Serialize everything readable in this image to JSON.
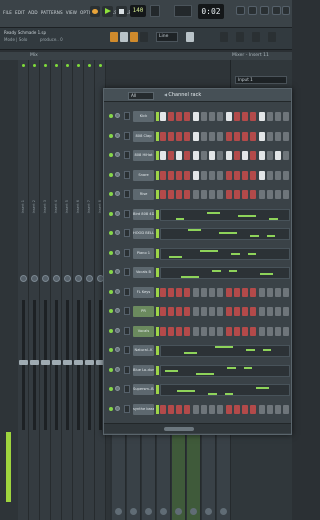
{
  "menu": [
    "FILE",
    "EDIT",
    "ADD",
    "PATTERNS",
    "VIEW",
    "OPTIONS",
    "TOOLS",
    "HELP"
  ],
  "transport": {
    "tempo": "140",
    "time": "0:02"
  },
  "project": {
    "title": "Ready Schmade 1.sp",
    "mode": "Mode | Solo",
    "version": "produce.. 0"
  },
  "toolbar2": {
    "pattern": "Line"
  },
  "mixer": {
    "header": "Mix",
    "insert_label": "Mixer - Insert 11",
    "input": "Input 1"
  },
  "mixer_strips": [
    "Insert 1",
    "Insert 2",
    "Insert 3",
    "Insert 4",
    "Insert 5",
    "Insert 6",
    "Insert 7",
    "Insert 8"
  ],
  "rack": {
    "filter": "All",
    "title": "Channel rack",
    "channels": [
      {
        "name": "Kick",
        "type": "steps",
        "steps": [
          1,
          0,
          0,
          0,
          1,
          0,
          0,
          0,
          1,
          0,
          0,
          0,
          1,
          0,
          0,
          0
        ]
      },
      {
        "name": "808 Clap",
        "type": "steps",
        "steps": [
          0,
          0,
          0,
          0,
          1,
          0,
          0,
          0,
          0,
          0,
          0,
          0,
          1,
          0,
          0,
          0
        ]
      },
      {
        "name": "808 HiHat",
        "type": "steps",
        "steps": [
          1,
          0,
          1,
          0,
          1,
          0,
          1,
          0,
          1,
          0,
          1,
          0,
          1,
          0,
          1,
          0
        ]
      },
      {
        "name": "Snare",
        "type": "steps",
        "steps": [
          0,
          0,
          0,
          0,
          1,
          0,
          0,
          0,
          0,
          0,
          0,
          0,
          1,
          0,
          0,
          0
        ]
      },
      {
        "name": "Rise",
        "type": "steps",
        "steps": [
          0,
          0,
          0,
          0,
          0,
          0,
          0,
          0,
          0,
          0,
          0,
          0,
          0,
          0,
          0,
          0
        ]
      },
      {
        "name": "Bird 808 4D",
        "type": "roll"
      },
      {
        "name": "HOOD BELL",
        "type": "roll"
      },
      {
        "name": "Piano 1",
        "type": "roll"
      },
      {
        "name": "Vocals B",
        "type": "roll"
      },
      {
        "name": "FL Keys",
        "type": "steps",
        "steps": [
          0,
          0,
          0,
          0,
          0,
          0,
          0,
          0,
          0,
          0,
          0,
          0,
          0,
          0,
          0,
          0
        ]
      },
      {
        "name": "PR",
        "type": "steps",
        "steps": [
          0,
          0,
          0,
          0,
          0,
          0,
          0,
          0,
          0,
          0,
          0,
          0,
          0,
          0,
          0,
          0
        ],
        "green": true
      },
      {
        "name": "Vocals",
        "type": "steps",
        "steps": [
          0,
          0,
          0,
          0,
          0,
          0,
          0,
          0,
          0,
          0,
          0,
          0,
          0,
          0,
          0,
          0
        ],
        "green": true
      },
      {
        "name": "Natural..K",
        "type": "roll"
      },
      {
        "name": "Blue Lo-dun",
        "type": "roll"
      },
      {
        "name": "Supersm..Ballistic",
        "type": "roll"
      },
      {
        "name": "synthe bass",
        "type": "steps",
        "steps": [
          0,
          0,
          0,
          0,
          0,
          0,
          0,
          0,
          0,
          0,
          0,
          0,
          0,
          0,
          0,
          0
        ]
      }
    ]
  }
}
